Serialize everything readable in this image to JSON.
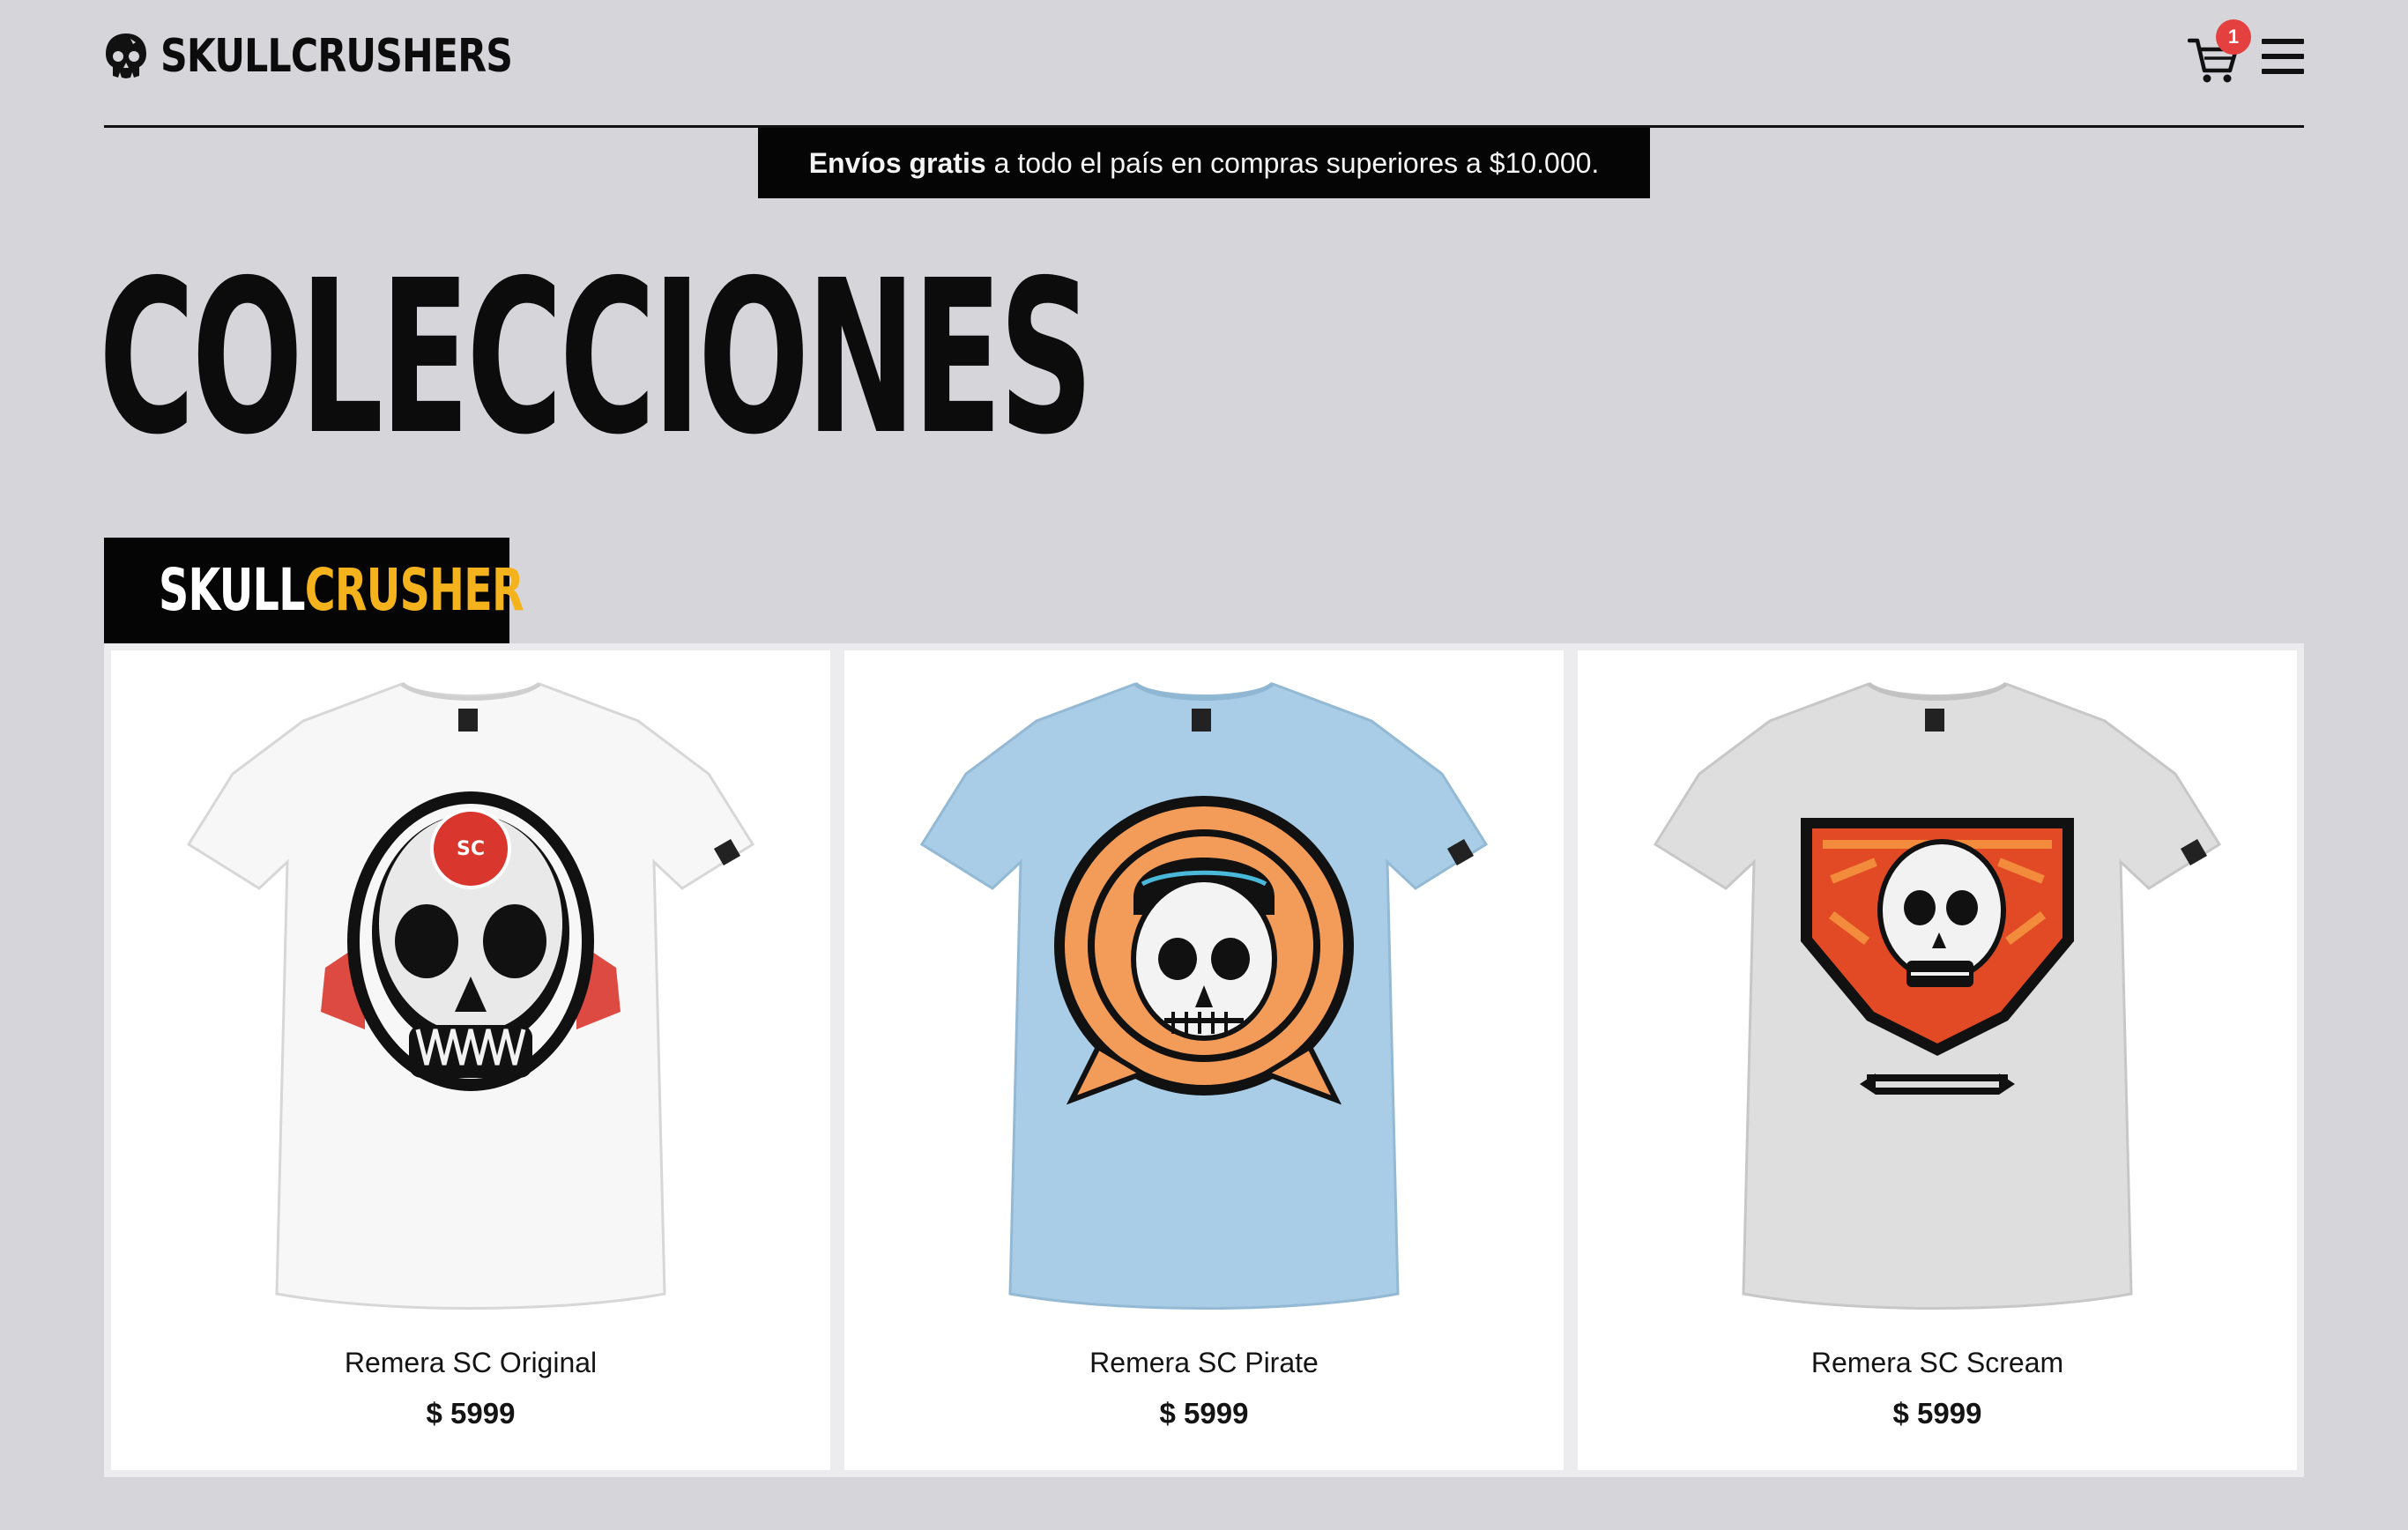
{
  "brand": {
    "name": "SKULLCRUSHERS"
  },
  "cart": {
    "count": "1"
  },
  "promo": {
    "bold": "Envíos gratis",
    "rest": "a todo el país en compras superiores a $10.000."
  },
  "page": {
    "title": "COLECCIONES"
  },
  "collection": {
    "name_white": "SKULL",
    "name_yellow": "CRUSHER"
  },
  "products": [
    {
      "name": "Remera SC Original",
      "price": "$ 5999",
      "shirt_color": "#f7f7f7",
      "design": "skull-red-badge"
    },
    {
      "name": "Remera SC Pirate",
      "price": "$ 5999",
      "shirt_color": "#a9cde6",
      "design": "skull-pirate-orange"
    },
    {
      "name": "Remera SC Scream",
      "price": "$ 5999",
      "shirt_color": "#dedede",
      "design": "skull-scream-shield"
    }
  ],
  "colors": {
    "background": "#d5d5da",
    "accent_yellow": "#f4b21c",
    "badge_red": "#e4403f",
    "black": "#050505"
  }
}
